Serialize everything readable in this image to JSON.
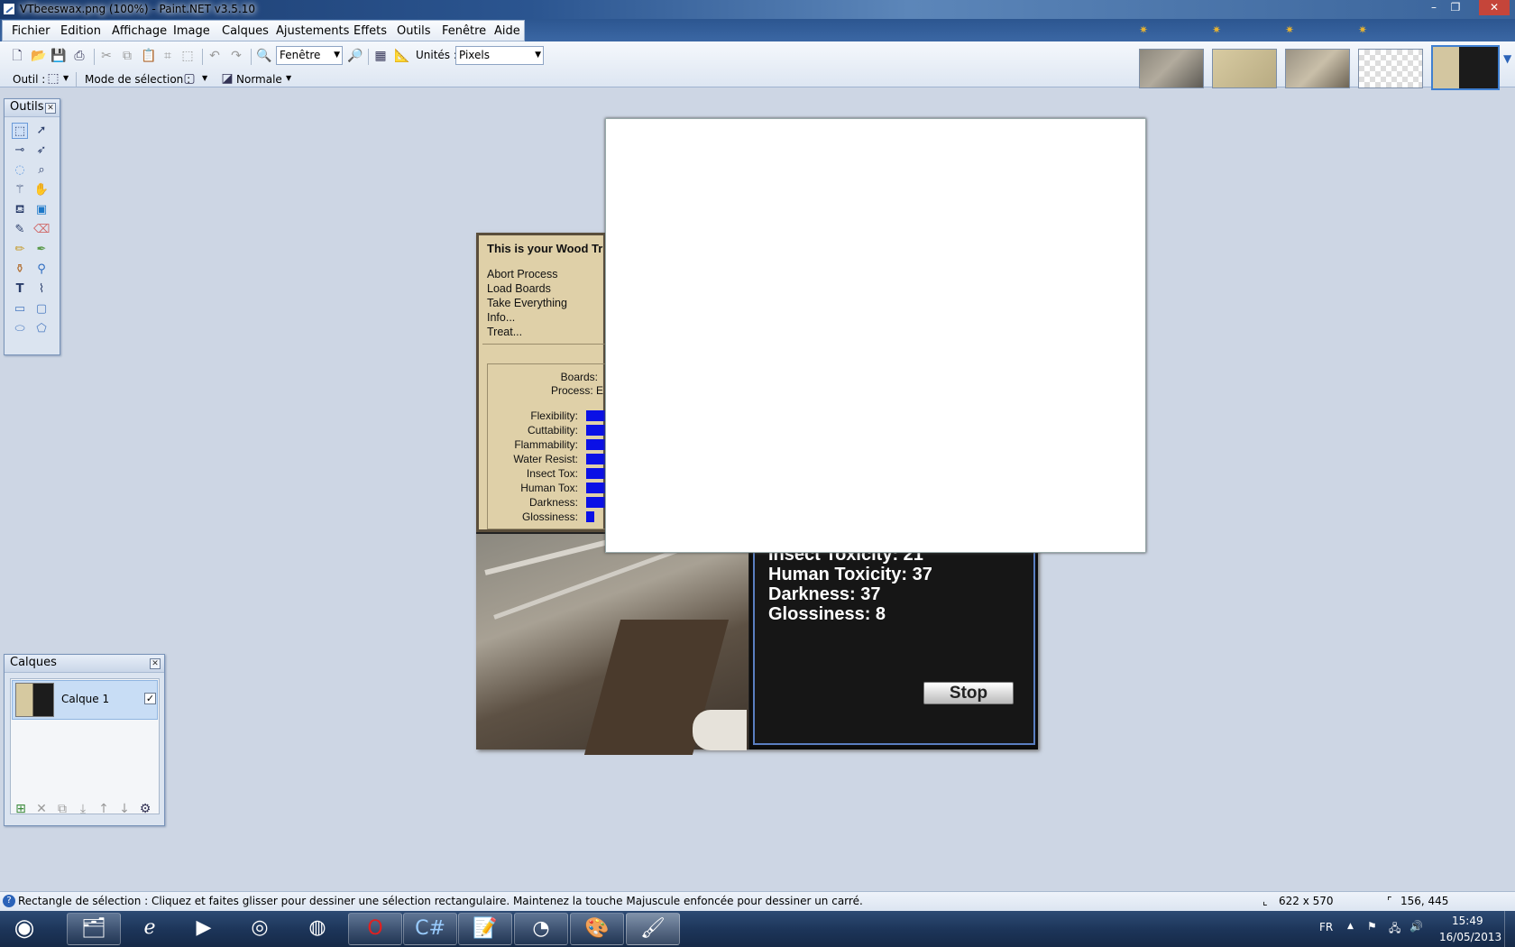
{
  "window": {
    "title": "VTbeeswax.png (100%) - Paint.NET v3.5.10",
    "controls": {
      "minimize": "–",
      "restore": "❐",
      "close": "✕"
    }
  },
  "menu": [
    "Fichier",
    "Edition",
    "Affichage",
    "Image",
    "Calques",
    "Ajustements",
    "Effets",
    "Outils",
    "Fenêtre",
    "Aide"
  ],
  "toolbar": {
    "zoom_value": "Fenêtre",
    "units_label": "Unités :",
    "units_value": "Pixels",
    "tool_label": "Outil :",
    "selection_mode_label": "Mode de sélection :",
    "blend_mode": "Normale"
  },
  "image_tabs": {
    "count": 5,
    "active_index": 4
  },
  "tools_panel": {
    "title": "Outils"
  },
  "layers_panel": {
    "title": "Calques",
    "layer_name": "Calque 1",
    "layer_visible": true
  },
  "canvas": {
    "game_title": "This is your Wood Tr",
    "game_menu": [
      "Abort Process",
      "Load Boards",
      "Take Everything",
      "Info...",
      "Treat..."
    ],
    "boards_label": "Boards:",
    "process_label": "Process: E",
    "attributes": [
      {
        "label": "Flexibility:",
        "level": 1
      },
      {
        "label": "Cuttability:",
        "level": 1
      },
      {
        "label": "Flammability:",
        "level": 1
      },
      {
        "label": "Water Resist:",
        "level": 1
      },
      {
        "label": "Insect Tox:",
        "level": 1
      },
      {
        "label": "Human Tox:",
        "level": 1
      },
      {
        "label": "Darkness:",
        "level": 1
      },
      {
        "label": "Glossiness:",
        "level": 0.4
      }
    ],
    "info_lines": [
      "Insect Toxicity: 21",
      "Human Toxicity: 37",
      "Darkness: 37",
      "Glossiness: 8"
    ],
    "stop_button": "Stop"
  },
  "statusbar": {
    "message": "Rectangle de sélection : Cliquez et faites glisser pour dessiner une sélection rectangulaire. Maintenez la touche Majuscule enfoncée pour dessiner un carré.",
    "image_size": "622 x 570",
    "cursor_pos": "156, 445"
  },
  "taskbar": {
    "language": "FR",
    "time": "15:49",
    "date": "16/05/2013",
    "apps": [
      "start-orb",
      "explorer",
      "internet-explorer",
      "media-player",
      "safari",
      "firefox",
      "opera",
      "csharp-ide",
      "notepad",
      "chrome-like",
      "paint-app",
      "paint-net"
    ]
  }
}
